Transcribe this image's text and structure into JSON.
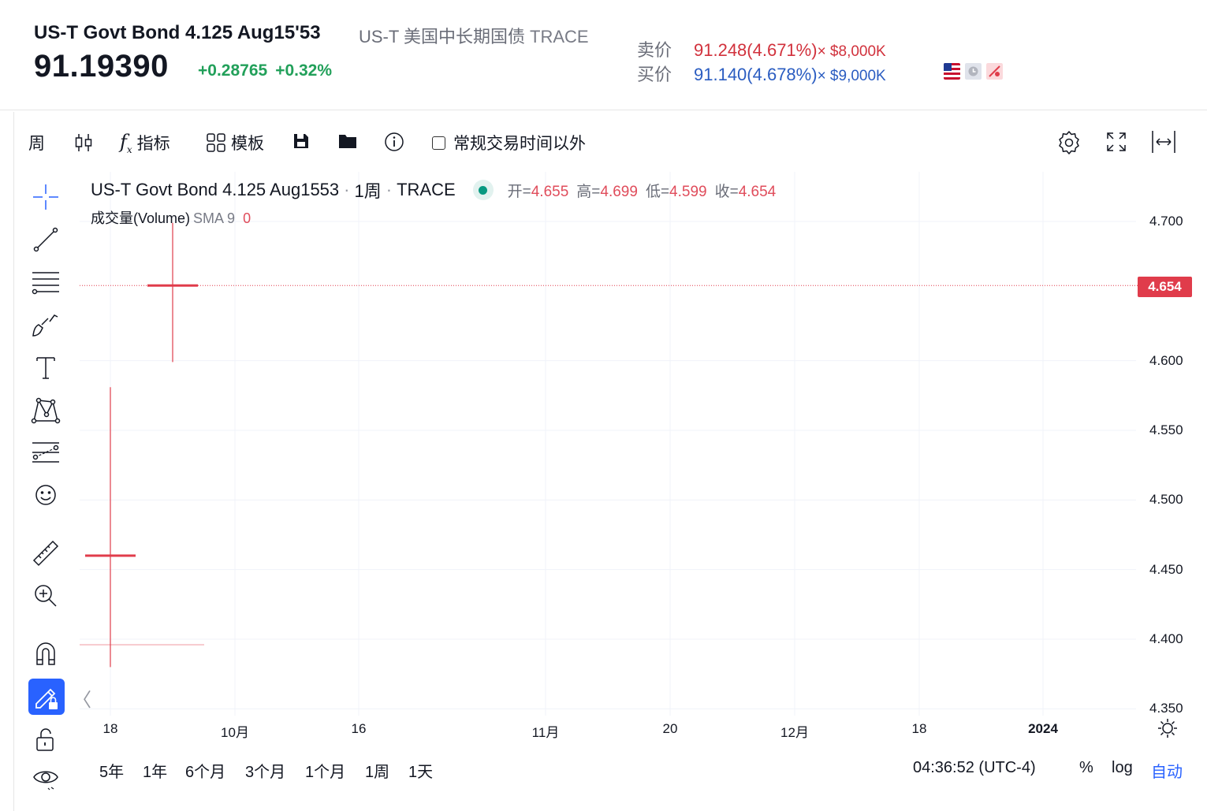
{
  "header": {
    "title": "US-T Govt Bond 4.125 Aug15'53",
    "subtitle": "US-T 美国中长期国债",
    "exchange": "TRACE",
    "price": "91.19390",
    "change": "+0.28765",
    "change_pct": "+0.32%",
    "ask": {
      "label": "卖价",
      "value": "91.248(4.671%)",
      "size": "× $8,000K"
    },
    "bid": {
      "label": "买价",
      "value": "91.140(4.678%)",
      "size": "× $9,000K"
    },
    "flags": [
      "us-flag-icon",
      "clock-icon",
      "delayed-icon"
    ]
  },
  "toolbar": {
    "interval": "周",
    "indicators": "指标",
    "templates": "模板",
    "extended_hours": "常规交易时间以外"
  },
  "legend": {
    "symbol": "US-T Govt Bond 4.125 Aug1553",
    "interval": "1周",
    "exchange": "TRACE",
    "open_label": "开=",
    "open": "4.655",
    "high_label": "高=",
    "high": "4.699",
    "low_label": "低=",
    "low": "4.599",
    "close_label": "收=",
    "close": "4.654",
    "volume_label": "成交量(Volume)",
    "volume_sma": "SMA 9",
    "volume_value": "0"
  },
  "chart_data": {
    "type": "ohlc",
    "y_ticks": [
      "4.700",
      "4.600",
      "4.550",
      "4.500",
      "4.450",
      "4.400",
      "4.350"
    ],
    "ylim": [
      4.35,
      4.735
    ],
    "x_ticks": [
      "18",
      "10月",
      "16",
      "11月",
      "20",
      "12月",
      "18",
      "2024"
    ],
    "last_price_label": "4.654",
    "last_price": 4.654,
    "bars": [
      {
        "x": "18",
        "open": 4.396,
        "high": 4.581,
        "low": 4.38,
        "close": 4.46
      },
      {
        "x": "25",
        "open": 4.655,
        "high": 4.699,
        "low": 4.599,
        "close": 4.654
      }
    ],
    "series": [
      {
        "values": [
          4.46,
          4.654
        ]
      }
    ]
  },
  "bottom": {
    "ranges": [
      "5年",
      "1年",
      "6个月",
      "3个月",
      "1个月",
      "1周",
      "1天"
    ],
    "time": "04:36:52 (UTC-4)",
    "percent": "%",
    "log": "log",
    "auto": "自动"
  },
  "colors": {
    "down": "#e03c4b",
    "up_text": "#22a05a",
    "accent": "#2962ff",
    "ask": "#d1313c",
    "bid": "#2a5cc1"
  }
}
